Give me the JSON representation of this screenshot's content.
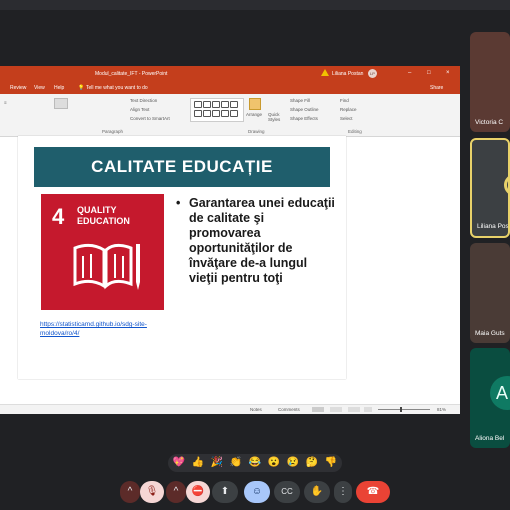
{
  "powerpoint": {
    "doc_title": "Modul_calitate_IFT  -  PowerPoint",
    "user_name": "Liliana Postan",
    "user_initials": "LP",
    "tabs": [
      "Review",
      "View",
      "Help"
    ],
    "tell_me": "Tell me what you want to do",
    "share": "Share",
    "ribbon": {
      "text_direction": "Text Direction",
      "align_text": "Align Text",
      "convert_smartart": "Convert to SmartArt",
      "paragraph": "Paragraph",
      "arrange": "Arrange",
      "quick_styles": "Quick Styles",
      "shape_fill": "Shape Fill",
      "shape_outline": "Shape Outline",
      "shape_effects": "Shape Effects",
      "drawing": "Drawing",
      "find": "Find",
      "replace": "Replace",
      "select": "Select",
      "editing": "Editing"
    },
    "slide": {
      "heading": "CALITATE EDUCAȚIE",
      "sdg_number": "4",
      "sdg_label_line1": "QUALITY",
      "sdg_label_line2": "EDUCATION",
      "bullet": "Garantarea unei educaţii de calitate şi promovarea oportunităţilor de învăţare de-a lungul vieţii pentru toţi",
      "link": "https://statisticamd.github.io/sdg-site-moldova/ro/4/"
    },
    "status": {
      "notes": "Notes",
      "comments": "Comments",
      "zoom": "81%"
    }
  },
  "participants": [
    {
      "name": "Victoria C"
    },
    {
      "name": "Liliana Pos"
    },
    {
      "name": "Maia Guts"
    },
    {
      "name": "Aliona Bel",
      "initial": "A"
    }
  ],
  "reactions": [
    "💖",
    "👍",
    "🎉",
    "👏",
    "😂",
    "😮",
    "😢",
    "🤔",
    "👎"
  ],
  "controls": {
    "mic_caret": "^",
    "mic_icon": "🎙",
    "cam_caret": "^",
    "cam_icon": "⛔",
    "present_icon": "⬆",
    "emoji_icon": "☺",
    "captions_icon": "CC",
    "hand_icon": "✋",
    "more_icon": "⋮",
    "end_icon": "☎"
  }
}
